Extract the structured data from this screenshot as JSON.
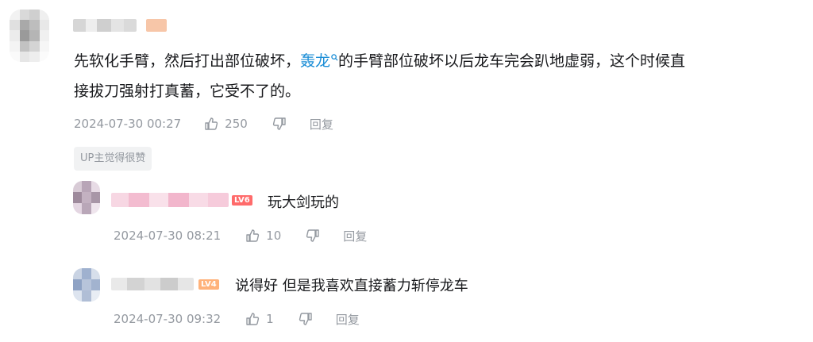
{
  "comment": {
    "text_before": "先软化手臂，然后打出部位破坏，",
    "link_text": "轰龙",
    "text_after_line1": "的手臂部位破坏以后龙车完会趴地虚弱，这个时候直",
    "text_line2": "接拔刀强射打真蓄，它受不了的。",
    "time": "2024-07-30 00:27",
    "likes": "250",
    "reply_label": "回复",
    "up_badge": "UP主觉得很赞"
  },
  "replies": [
    {
      "level": "LV6",
      "level_color": "#ff6b6b",
      "text": "玩大剑玩的",
      "time": "2024-07-30 08:21",
      "likes": "10",
      "reply_label": "回复"
    },
    {
      "level": "LV4",
      "level_color": "#ffb27a",
      "text": "说得好 但是我喜欢直接蓄力斩停龙车",
      "time": "2024-07-30 09:32",
      "likes": "1",
      "reply_label": "回复"
    }
  ],
  "icons": {
    "like": "thumbs-up-icon",
    "dislike": "thumbs-down-icon",
    "search": "search-icon"
  },
  "colors": {
    "link": "#1a8dd6",
    "meta": "#9499a0",
    "text": "#18191c"
  }
}
